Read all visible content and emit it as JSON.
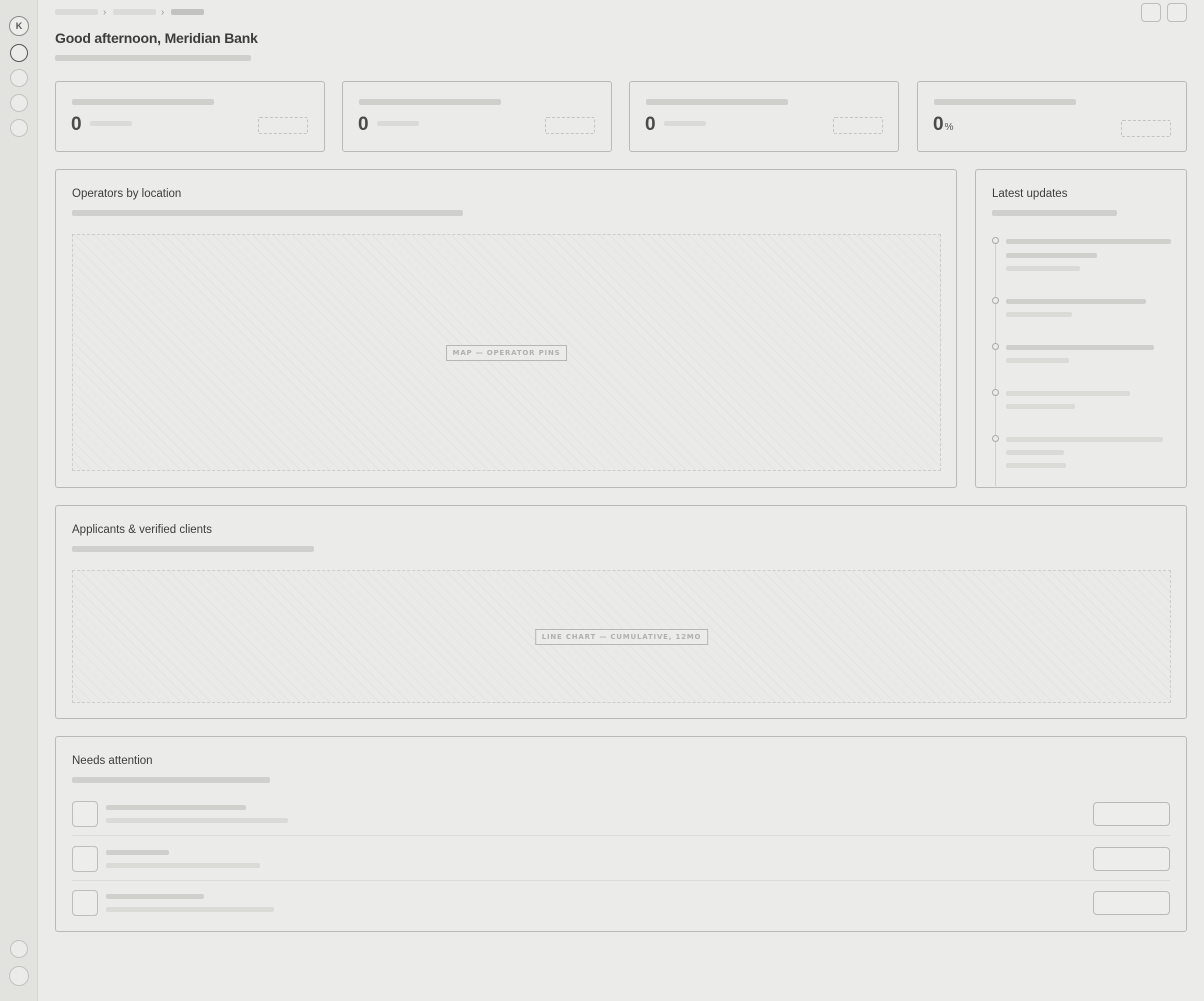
{
  "sidebar": {
    "avatar_initial": "K",
    "items": [
      {
        "icon": "circle-icon",
        "active": true
      },
      {
        "icon": "circle-icon",
        "active": false
      },
      {
        "icon": "circle-icon",
        "active": false
      },
      {
        "icon": "circle-icon",
        "active": false
      }
    ],
    "bottom_items": [
      {
        "icon": "circle-icon"
      },
      {
        "icon": "profile-circle-icon"
      }
    ]
  },
  "header": {
    "greeting": "Good afternoon, Meridian Bank"
  },
  "kpis": [
    {
      "value": "0",
      "unit": ""
    },
    {
      "value": "0",
      "unit": ""
    },
    {
      "value": "0",
      "unit": ""
    },
    {
      "value": "0",
      "unit": "%"
    }
  ],
  "map_card": {
    "title": "Operators by location",
    "placeholder": "MAP — OPERATOR PINS"
  },
  "updates_card": {
    "title": "Latest updates"
  },
  "chart_card": {
    "title": "Applicants & verified clients",
    "placeholder": "LINE CHART — CUMULATIVE, 12MO"
  },
  "attention_card": {
    "title": "Needs attention"
  }
}
